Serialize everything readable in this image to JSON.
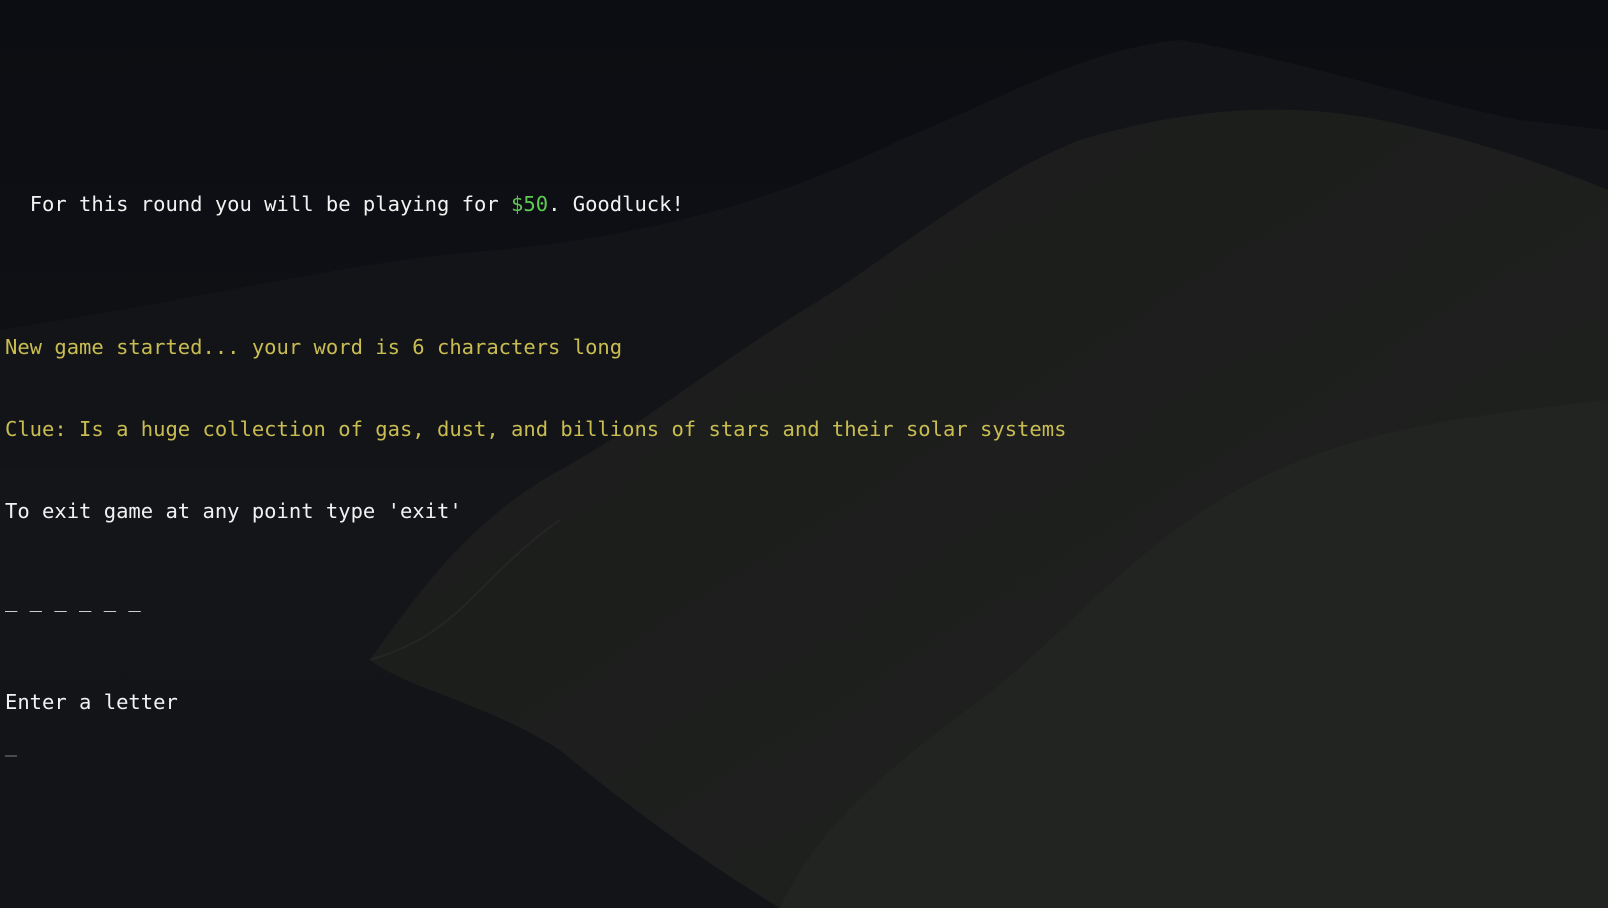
{
  "terminal": {
    "round_prefix": "For this round you will be playing for ",
    "round_amount": "$50",
    "round_suffix": ". Goodluck!",
    "game_started": "New game started... your word is 6 characters long",
    "clue": "Clue: Is a huge collection of gas, dust, and billions of stars and their solar systems",
    "exit_hint": "To exit game at any point type 'exit'",
    "word_blanks": "_ _ _ _ _ _",
    "prompt": "Enter a letter",
    "input_value": ""
  },
  "colors": {
    "background": "#101114",
    "text": "#f2f2f2",
    "info": "#c9bd52",
    "money": "#5fc954"
  }
}
